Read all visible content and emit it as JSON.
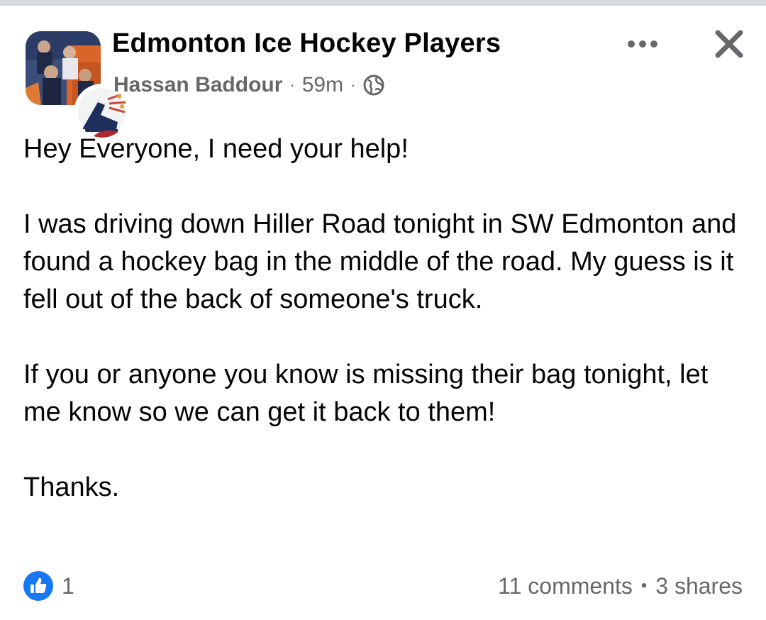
{
  "post": {
    "group_name": "Edmonton Ice Hockey Players",
    "author": "Hassan Baddour",
    "separator": "·",
    "time_ago": "59m",
    "privacy_icon": "globe-icon",
    "body": [
      "Hey Everyone, I need your help!",
      "I was driving down Hiller Road tonight in SW Edmonton and found a hockey bag in the middle of the road. My guess is it fell out of the back of someone's truck.",
      "If you or anyone you know is missing their bag tonight, let me know so we can get it back to them!",
      "Thanks."
    ]
  },
  "actions": {
    "more_icon": "more-options-icon",
    "close_icon": "close-icon"
  },
  "footer": {
    "reaction_icon": "like-icon",
    "reaction_count": "1",
    "comments": "11 comments",
    "dot": "•",
    "shares": "3 shares"
  },
  "colors": {
    "text_primary": "#050505",
    "text_secondary": "#65676b",
    "like_blue": "#1877f2",
    "divider": "#d7d9de"
  }
}
